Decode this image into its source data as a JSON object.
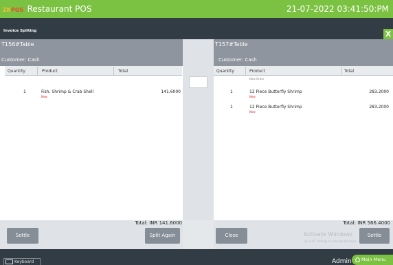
{
  "app": {
    "logo_zk": "ZK",
    "logo_pos": "POS",
    "title": "Restaurant POS",
    "datetime": "21-07-2022 03:41:50:PM"
  },
  "dialog": {
    "title": "Invoice Spliting",
    "close_label": "X"
  },
  "left_panel": {
    "table_label": "T156#Table",
    "customer_label": "Customer:",
    "customer_value": "Cash",
    "columns": [
      "Quantity",
      "Product",
      "Total"
    ],
    "rows": [
      {
        "qty": "1",
        "product": "Fish, Shrimp & Crab Shell",
        "status": "New",
        "total": "141.6000"
      }
    ],
    "total_text": "Total: INR 141.6000",
    "settle_label": "Settle",
    "split_again_label": "Split Again"
  },
  "right_panel": {
    "table_label": "T157#Table",
    "customer_label": "Customer:",
    "customer_value": "Cash",
    "columns": [
      "Quantity",
      "Product",
      "Total"
    ],
    "note": "New Order",
    "rows": [
      {
        "qty": "1",
        "product": "12 Piece Butterfly Shrimp",
        "status": "New",
        "total": "283.2000"
      },
      {
        "qty": "1",
        "product": "12 Piece Butterfly Shrimp",
        "status": "New",
        "total": "283.2000"
      }
    ],
    "total_text": "Total: INR 566.4000",
    "close_label": "Close",
    "settle_label": "Settle"
  },
  "watermark": {
    "line1": "Activate Windows",
    "line2": "Go to PC settings to activate Windows."
  },
  "bottom": {
    "keyboard_label": "Keyboard",
    "user": "Admin",
    "main_menu_label": "Main Menu"
  },
  "colors": {
    "brand_green": "#7cc242",
    "dark_bar": "#323c44",
    "panel_header": "#8e959e",
    "button": "#858d97",
    "status_red": "#e02020"
  }
}
